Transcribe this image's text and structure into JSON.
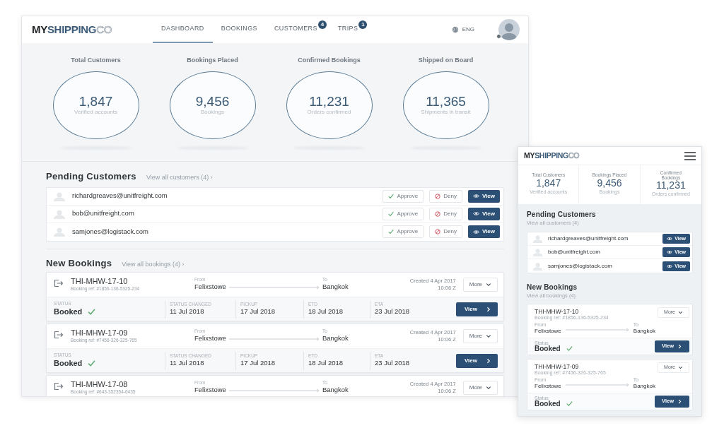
{
  "desktop": {
    "logo": [
      "MY",
      "SHIPPING",
      "CO"
    ],
    "nav": [
      {
        "label": "DASHBOARD",
        "selected": true
      },
      {
        "label": "BOOKINGS",
        "selected": false
      },
      {
        "label": "CUSTOMERS",
        "selected": false,
        "badge": "4"
      },
      {
        "label": "TRIPS",
        "selected": false,
        "badge": "1"
      }
    ],
    "language": "ENG",
    "stats": [
      {
        "title": "Total Customers",
        "value": "1,847",
        "caption": "Verified accounts"
      },
      {
        "title": "Bookings Placed",
        "value": "9,456",
        "caption": "Bookings"
      },
      {
        "title": "Confirmed Bookings",
        "value": "11,231",
        "caption": "Orders confirmed"
      },
      {
        "title": "Shipped on Board",
        "value": "11,365",
        "caption": "Shipments in transit"
      }
    ],
    "pending": {
      "title": "Pending Customers",
      "link": "View all customers (4) ›",
      "rows": [
        {
          "email": "richardgreaves@unitfreight.com",
          "approve": "Approve",
          "deny": "Deny",
          "view": "View"
        },
        {
          "email": "bob@unitfreight.com",
          "approve": "Approve",
          "deny": "Deny",
          "view": "View"
        },
        {
          "email": "samjones@logistack.com",
          "approve": "Approve",
          "deny": "Deny",
          "view": "View"
        }
      ]
    },
    "bookings": {
      "title": "New Bookings",
      "link": "View all bookings (4) ›",
      "cards": [
        {
          "id": "THI-MHW-17-10",
          "ref": "Booking ref: #1856-136-5325-234",
          "from_label": "From",
          "from": "Felixstowe",
          "to_label": "To",
          "to": "Bangkok",
          "created": "Created 4 Apr 2017",
          "time": "10:06 Z",
          "more": "More",
          "status_label": "STATUS",
          "status": "Booked",
          "fields": [
            {
              "label": "STATUS CHANGED",
              "value": "11 Jul 2018"
            },
            {
              "label": "PICKUP",
              "value": "17 Jul 2018"
            },
            {
              "label": "ETD",
              "value": "18 Jul 2018"
            },
            {
              "label": "ETA",
              "value": "23 Jul 2018"
            }
          ],
          "view": "View"
        },
        {
          "id": "THI-MHW-17-09",
          "ref": "Booking ref: #7456-326-325-765",
          "from_label": "From",
          "from": "Felixstowe",
          "to_label": "To",
          "to": "Bangkok",
          "created": "Created 4 Apr 2017",
          "time": "10:06 Z",
          "more": "More",
          "status_label": "STATUS",
          "status": "Booked",
          "fields": [
            {
              "label": "STATUS CHANGED",
              "value": "11 Jul 2018"
            },
            {
              "label": "PICKUP",
              "value": "17 Jul 2018"
            },
            {
              "label": "ETD",
              "value": "18 Jul 2018"
            },
            {
              "label": "ETA",
              "value": "23 Jul 2018"
            }
          ],
          "view": "View"
        },
        {
          "id": "THI-MHW-17-08",
          "ref": "Booking ref: #643-352354-6435",
          "from_label": "From",
          "from": "Felixstowe",
          "to_label": "To",
          "to": "Bangkok",
          "created": "Created 4 Apr 2017",
          "time": "10:06 Z",
          "more": "More"
        }
      ]
    }
  },
  "mobile": {
    "logo": [
      "MY",
      "SHIPPING",
      "CO"
    ],
    "stats": [
      {
        "title": "Total Customers",
        "value": "1,847",
        "caption": "Verified accounts"
      },
      {
        "title": "Bookings Placed",
        "value": "9,456",
        "caption": "Bookings"
      },
      {
        "title": "Confirmed Bookings",
        "value": "11,231",
        "caption": "Orders confirmed"
      }
    ],
    "pending": {
      "title": "Pending Customers",
      "link": "View all customers (4)",
      "rows": [
        {
          "email": "richardgreaves@unitfreight.com",
          "view": "View"
        },
        {
          "email": "bob@unitfreight.com",
          "view": "View"
        },
        {
          "email": "samjones@logistack.com",
          "view": "View"
        }
      ]
    },
    "bookings": {
      "title": "New Bookings",
      "link": "View all bookings (4)",
      "cards": [
        {
          "id": "THI-MHW-17-10",
          "ref": "Booking ref: #1856-136-5325-234",
          "from_label": "From",
          "from": "Felixstowe",
          "to_label": "To",
          "to": "Bangkok",
          "more": "More",
          "status_label": "Status",
          "status": "Booked",
          "view": "View"
        },
        {
          "id": "THI-MHW-17-09",
          "ref": "Booking ref: #7456-326-325-765",
          "from_label": "From",
          "from": "Felixstowe",
          "to_label": "To",
          "to": "Bangkok",
          "more": "More",
          "status_label": "Status",
          "status": "Booked",
          "view": "View"
        }
      ]
    }
  }
}
